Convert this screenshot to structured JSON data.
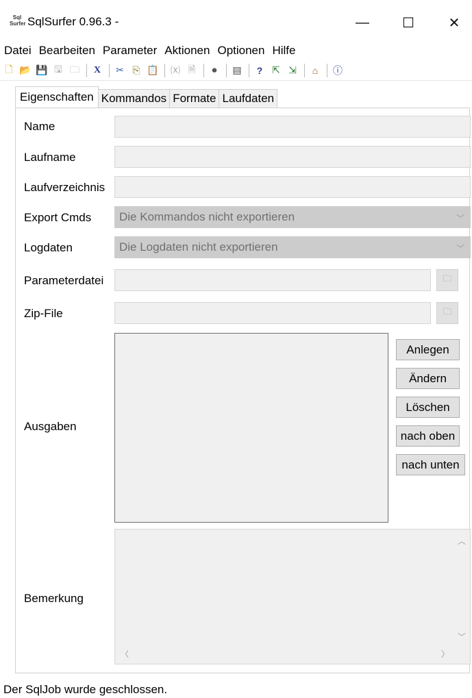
{
  "window": {
    "app_icon_text": "Sql\nSurfer",
    "title": "SqlSurfer 0.96.3 -",
    "min_glyph": "—",
    "max_glyph": "☐",
    "close_glyph": "✕"
  },
  "menu": [
    "Datei",
    "Bearbeiten",
    "Parameter",
    "Aktionen",
    "Optionen",
    "Hilfe"
  ],
  "toolbar": {
    "icons": [
      {
        "name": "new-icon",
        "glyph": "🗋"
      },
      {
        "name": "open-icon",
        "glyph": "📂"
      },
      {
        "name": "save-icon",
        "glyph": "💾"
      },
      {
        "name": "save-as-icon",
        "glyph": "🖫"
      },
      {
        "name": "folder-icon",
        "glyph": "🗀"
      },
      {
        "name": "delete-icon",
        "glyph": "X"
      },
      {
        "name": "cut-icon",
        "glyph": "✂"
      },
      {
        "name": "copy-icon",
        "glyph": "⎘"
      },
      {
        "name": "paste-icon",
        "glyph": "📋"
      },
      {
        "name": "variable-icon",
        "glyph": "⒳"
      },
      {
        "name": "document-icon",
        "glyph": "🗎"
      },
      {
        "name": "run-icon",
        "glyph": "⏺"
      },
      {
        "name": "properties-icon",
        "glyph": "▤"
      },
      {
        "name": "help-icon",
        "glyph": "?"
      },
      {
        "name": "export-icon",
        "glyph": "⇱"
      },
      {
        "name": "import-icon",
        "glyph": "⇲"
      },
      {
        "name": "home-icon",
        "glyph": "⌂"
      },
      {
        "name": "about-icon",
        "glyph": "ⓘ"
      }
    ]
  },
  "tabs": [
    "Eigenschaften",
    "Kommandos",
    "Formate",
    "Laufdaten"
  ],
  "form": {
    "name_label": "Name",
    "laufname_label": "Laufname",
    "laufverzeichnis_label": "Laufverzeichnis",
    "export_cmds_label": "Export Cmds",
    "export_cmds_value": "Die Kommandos nicht exportieren",
    "logdaten_label": "Logdaten",
    "logdaten_value": "Die Logdaten nicht exportieren",
    "parameterdatei_label": "Parameterdatei",
    "zipfile_label": "Zip-File",
    "ausgaben_label": "Ausgaben",
    "bemerkung_label": "Bemerkung"
  },
  "buttons": {
    "anlegen": "Anlegen",
    "aendern": "Ändern",
    "loeschen": "Löschen",
    "nach_oben": "nach oben",
    "nach_unten": "nach unten"
  },
  "status": "Der SqlJob wurde geschlossen."
}
